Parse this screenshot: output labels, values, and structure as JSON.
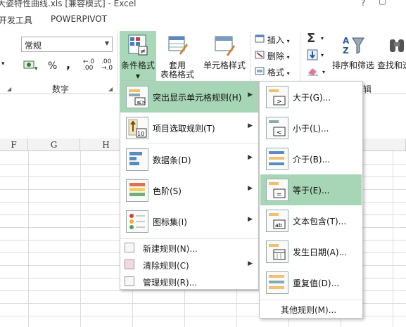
{
  "window": {
    "title": "大姿特性曲线.xls  [兼容模式] - Excel",
    "controls": [
      "?",
      "▢"
    ]
  },
  "tabs": [
    "开发工具",
    "POWERPIVOT"
  ],
  "ribbon": {
    "number_format": "常规",
    "number_group_label": "数字",
    "percent": "%",
    "comma": ",",
    "inc_decimal": "←.0\n.00",
    "dec_decimal": ".00\n→.0",
    "cond_format": "条件格式",
    "table_format_line1": "套用",
    "table_format_line2": "表格格式",
    "cell_style": "单元格样式",
    "insert": "插入",
    "delete": "删除",
    "format": "格式",
    "sort_filter": "排序和筛选",
    "find_select": "查找和选",
    "edit_group_partial": "辑"
  },
  "columns": [
    "F",
    "G",
    "H"
  ],
  "menu": {
    "main_items": [
      {
        "label": "突出显示单元格规则(H)",
        "has_submenu": true,
        "highlighted": true
      },
      {
        "label": "项目选取规则(T)",
        "has_submenu": true,
        "highlighted": false
      },
      {
        "label": "数据条(D)",
        "has_submenu": true,
        "highlighted": false
      },
      {
        "label": "色阶(S)",
        "has_submenu": true,
        "highlighted": false
      },
      {
        "label": "图标集(I)",
        "has_submenu": true,
        "highlighted": false
      }
    ],
    "small_items": [
      {
        "label": "新建规则(N)...",
        "has_submenu": false
      },
      {
        "label": "清除规则(C)",
        "has_submenu": true
      },
      {
        "label": "管理规则(R)...",
        "has_submenu": false
      }
    ]
  },
  "submenu": {
    "items": [
      {
        "label": "大于(G)...",
        "highlighted": false
      },
      {
        "label": "小于(L)...",
        "highlighted": false
      },
      {
        "label": "介于(B)...",
        "highlighted": false
      },
      {
        "label": "等于(E)...",
        "highlighted": true
      },
      {
        "label": "文本包含(T)...",
        "highlighted": false
      },
      {
        "label": "发生日期(A)...",
        "highlighted": false
      },
      {
        "label": "重复值(D)...",
        "highlighted": false
      }
    ],
    "more": "其他规则(M)..."
  },
  "colors": {
    "highlight": "#a6d6b6",
    "ribbon_selected": "#a8d8b8"
  }
}
